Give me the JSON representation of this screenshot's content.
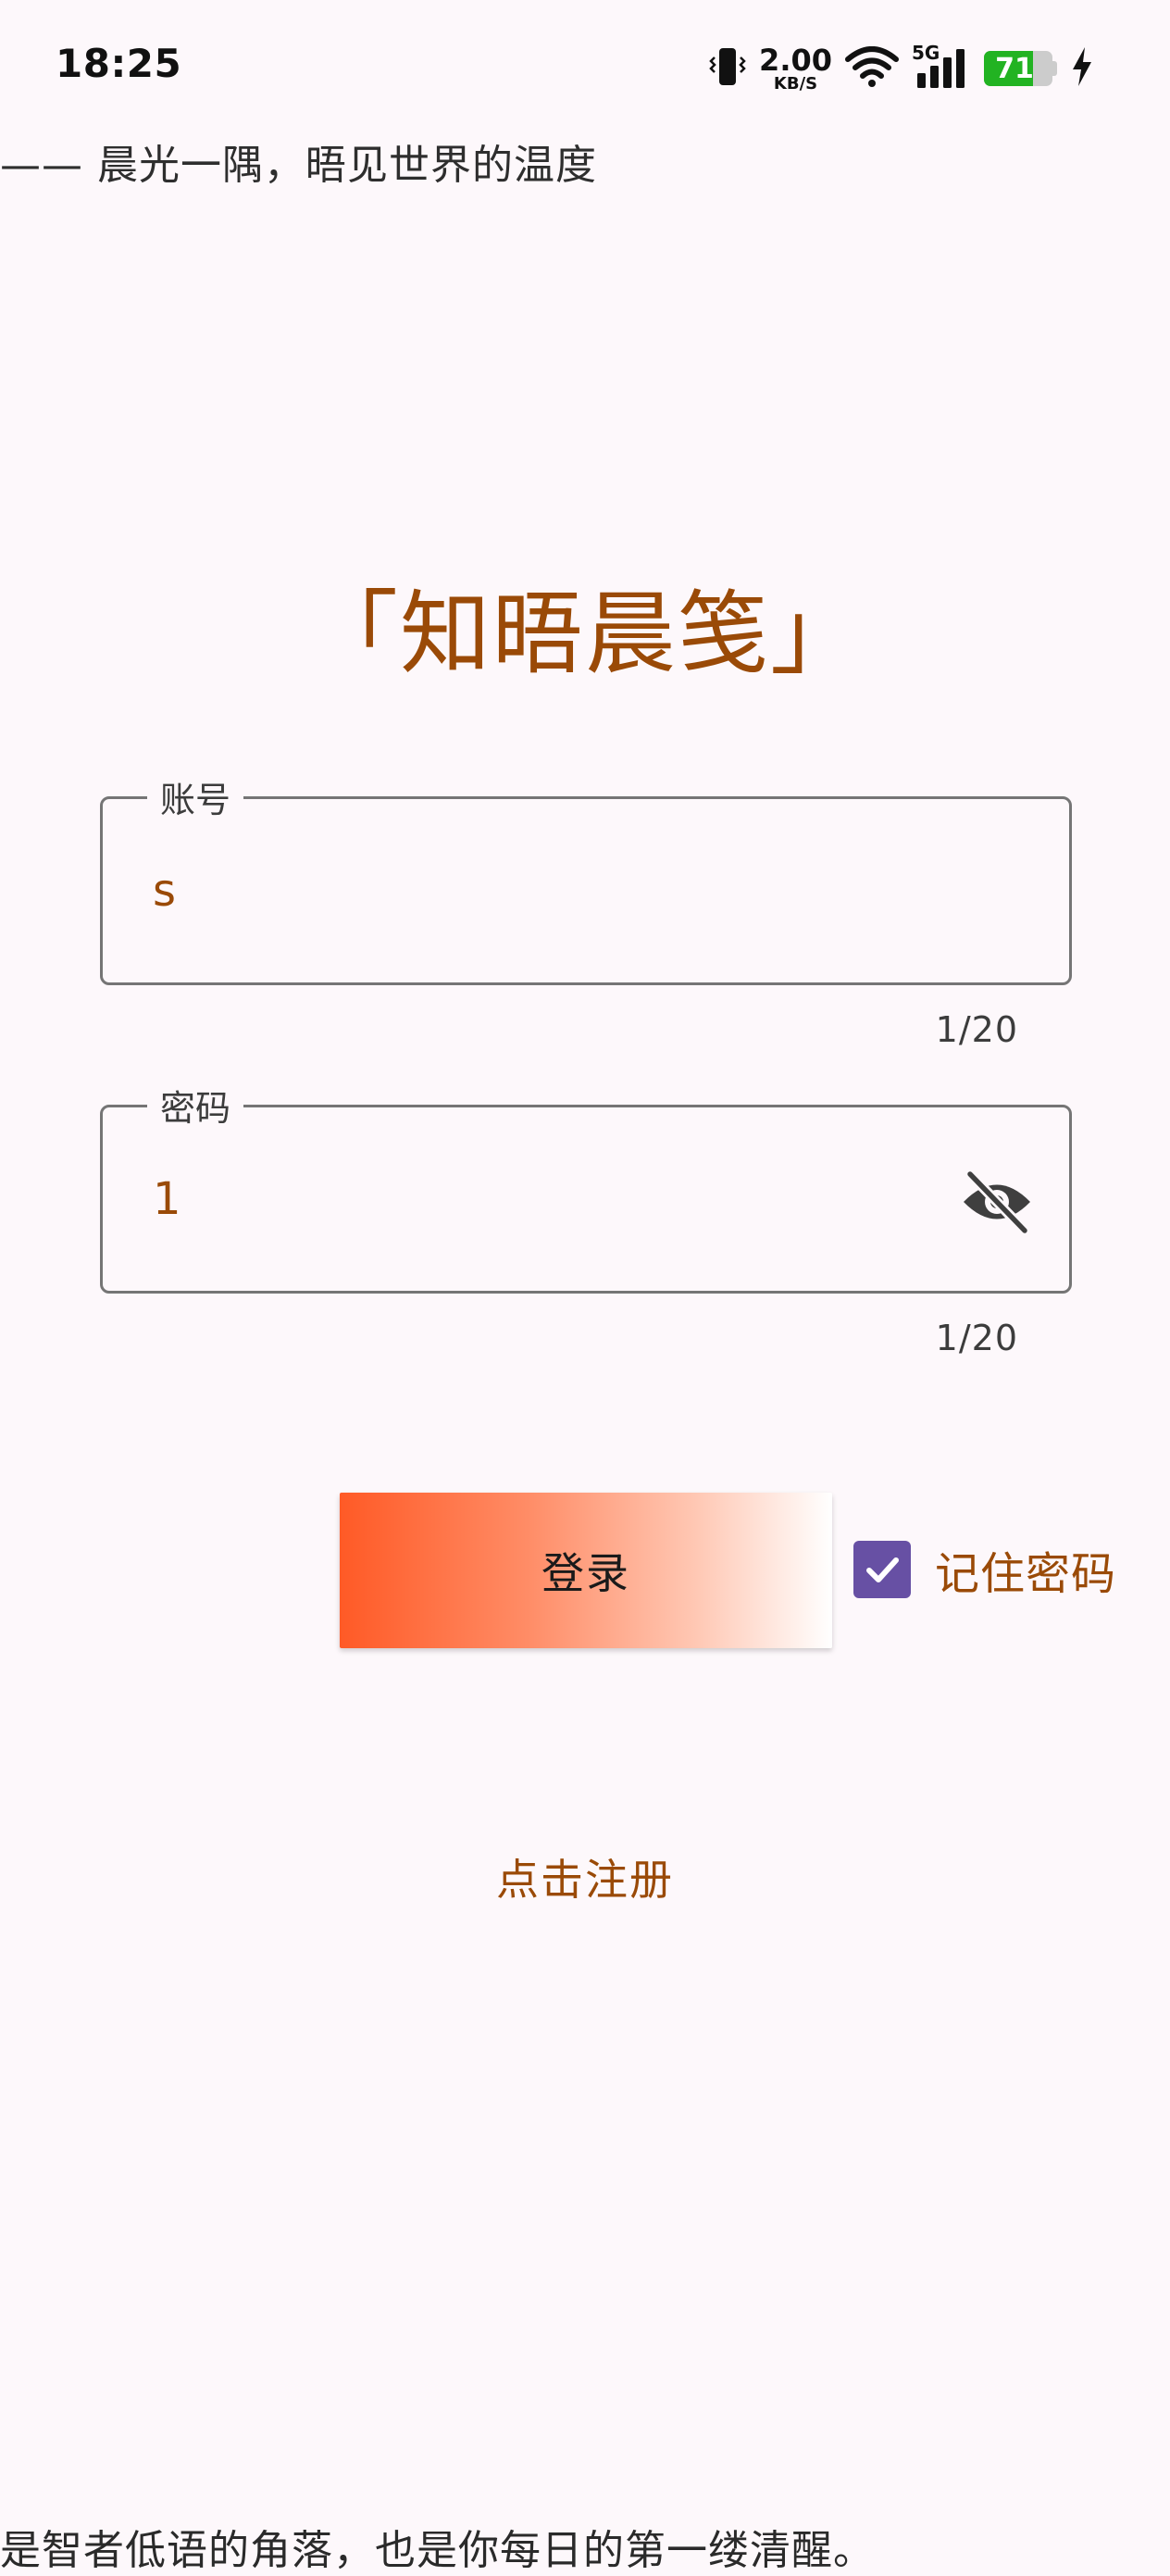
{
  "status_bar": {
    "time": "18:25",
    "net_speed_value": "2.00",
    "net_speed_unit": "KB/S",
    "network_type": "5G",
    "battery_level": "71",
    "battery_fraction": 0.71,
    "battery_color": "#22b322",
    "icons": [
      "vibrate-icon",
      "wifi-icon",
      "signal-icon",
      "battery-icon",
      "charging-icon"
    ]
  },
  "header": {
    "quote": "—— 晨光一隅，晤见世界的温度",
    "title": "「知晤晨笺」"
  },
  "form": {
    "account": {
      "label": "账号",
      "value": "s",
      "counter": "1/20"
    },
    "password": {
      "label": "密码",
      "value": "1",
      "counter": "1/20",
      "toggle_icon": "eye-off-icon"
    },
    "login_label": "登录",
    "remember_label": "记住密码",
    "remember_checked": true,
    "register_label": "点击注册"
  },
  "footer": {
    "quote": "是智者低语的角落，也是你每日的第一缕清醒。"
  },
  "colors": {
    "accent": "#9a4a07",
    "checkbox": "#6750a4",
    "button_start": "#ff5a26",
    "background": "#fdf8fb"
  }
}
